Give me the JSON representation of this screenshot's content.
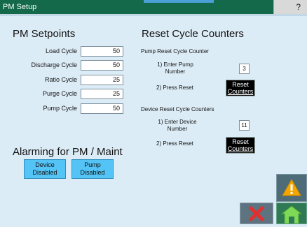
{
  "title_bar": {
    "title": "PM Setup",
    "help_label": "?"
  },
  "setpoints": {
    "heading": "PM Setpoints",
    "rows": [
      {
        "label": "Load Cycle",
        "value": "50"
      },
      {
        "label": "Discharge Cycle",
        "value": "50"
      },
      {
        "label": "Ratio Cycle",
        "value": "25"
      },
      {
        "label": "Purge Cycle",
        "value": "25"
      },
      {
        "label": "Pump Cycle",
        "value": "50"
      }
    ]
  },
  "reset": {
    "heading": "Reset Cycle Counters",
    "pump": {
      "title": "Pump Reset Cycle Counter",
      "step1_line1": "1) Enter Pump",
      "step1_line2": "Number",
      "number": "3",
      "step2": "2) Press Reset",
      "button_line1": "Reset",
      "button_line2": "Counters"
    },
    "device": {
      "title": "Device Reset Cycle Counters",
      "step1_line1": "1) Enter Device",
      "step1_line2": "Number",
      "number": "11",
      "step2": "2) Press Reset",
      "button_line1": "Reset",
      "button_line2": "Counters"
    }
  },
  "alarming": {
    "heading": "Alarming for PM / Maint",
    "device_button": {
      "line1": "Device",
      "line2": "Disabled"
    },
    "pump_button": {
      "line1": "Pump",
      "line2": "Disabled"
    }
  },
  "icons": {
    "warning": "warning-icon",
    "cancel": "close-icon",
    "home": "home-icon",
    "colors": {
      "warning": "#f3a600",
      "cancel": "#e03030",
      "home": "#7ed957"
    }
  }
}
